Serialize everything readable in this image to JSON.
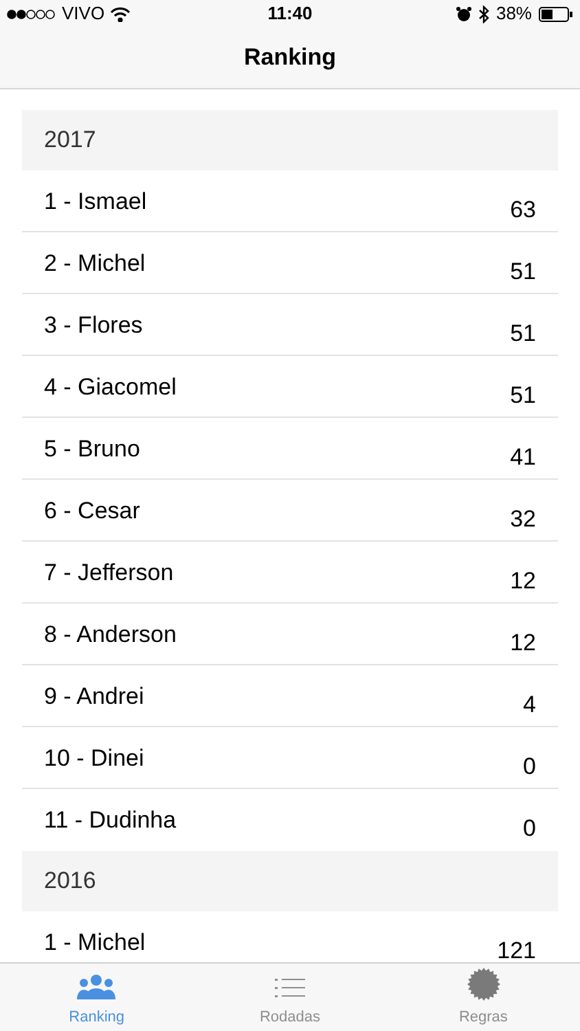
{
  "status_bar": {
    "carrier": "VIVO",
    "time": "11:40",
    "battery": "38%"
  },
  "nav_bar": {
    "title": "Ranking"
  },
  "sections": [
    {
      "year": "2017",
      "rows": [
        {
          "name": "1 - Ismael",
          "points": "63"
        },
        {
          "name": "2 - Michel",
          "points": "51"
        },
        {
          "name": "3 - Flores",
          "points": "51"
        },
        {
          "name": "4 - Giacomel",
          "points": "51"
        },
        {
          "name": "5 - Bruno",
          "points": "41"
        },
        {
          "name": "6 - Cesar",
          "points": "32"
        },
        {
          "name": "7 - Jefferson",
          "points": "12"
        },
        {
          "name": "8 - Anderson",
          "points": "12"
        },
        {
          "name": "9 - Andrei",
          "points": "4"
        },
        {
          "name": "10 - Dinei",
          "points": "0"
        },
        {
          "name": "11 - Dudinha",
          "points": "0"
        }
      ]
    },
    {
      "year": "2016",
      "rows": [
        {
          "name": "1 - Michel",
          "points": "121"
        }
      ]
    }
  ],
  "tab_bar": [
    {
      "kind": "people",
      "label": "Ranking",
      "selected": true
    },
    {
      "kind": "list",
      "label": "Rodadas",
      "selected": false
    },
    {
      "kind": "gear",
      "label": "Regras",
      "selected": false
    }
  ]
}
